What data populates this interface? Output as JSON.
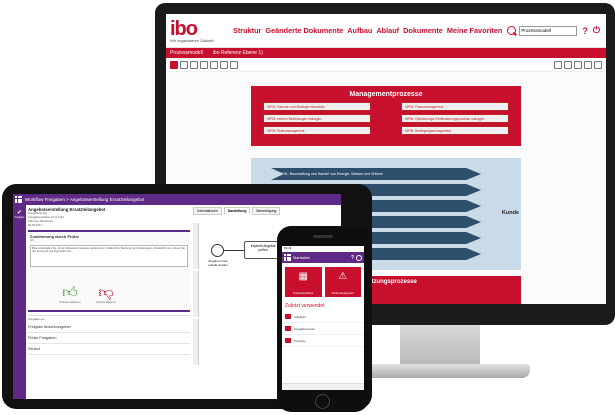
{
  "monitor": {
    "logo": "ibo",
    "tagline": "Wir organisieren Zukunft.",
    "nav": [
      "Struktur",
      "Geänderte Dokumente",
      "Aufbau",
      "Ablauf",
      "Dokumente",
      "Meine Favoriten"
    ],
    "search_value": "Prozessmodell",
    "help_label": "?",
    "power_label": "⏻",
    "breadcrumb": [
      "Prozessmodell",
      "ibo Referenz Ebene 1)"
    ],
    "management_title": "Managementprozesse",
    "management_items": [
      "MP01: Visionen und Strategie entwickeln",
      "MP04: Finanzmanagement",
      "MP02: externe Beziehungen managen",
      "MP06: Optimierungs-/Verbesserungsprozesse managen",
      "MP03: Risikomanagement",
      "MP05: Beteiligungsmanagement"
    ],
    "core_items": [
      "KP01: Beschaffung und Handel von Energie, Wasser und Wärme",
      "KP02: Verkauf von Energie, Wasser und Wärme",
      "...ung und Bau von Anlagen und Netzen",
      "...b und Instandhaltung von Anlagen und Netzen",
      "...von Energie-, Wasser- und Wärmedienstleistungen",
      "...eb von technischen Produkten und Dienstleistungen"
    ],
    "core_side_label": "Kunde",
    "support_title": "...rstützungsprozesse"
  },
  "tablet": {
    "header_title": "Workflow Freigaben > Angebotserstellung Ersatzteilangebot",
    "sidebar_label": "Freigabe",
    "doc_title": "Angebotserstellung Ersatzteilangebot",
    "doc_meta": [
      "Freigabeantrag",
      "Freigabeworkflow (v1.0.0.0p)",
      "Start des Workflows",
      "09.05.2017"
    ],
    "approval_title": "Zustimmung durch Prüfer",
    "approval_role": "Ich",
    "approval_hint": "Bitte entscheiden Sie, ob der Dokument freigeben werden kann. Sollten Ihrer Meinung nach Änderungen erforderlich sein, lehnen Sie den Antrag ab und begründen Sie...",
    "approve_label": "Prozess zustimmen",
    "reject_label": "Prozess ablehnen",
    "release_label": "Freigaben an",
    "collapsed_sections": [
      "Freigabe Abschlussgeber",
      "Finale Freigaben",
      "Verlauf"
    ],
    "tabs": [
      "Informationen",
      "Darstellung",
      "Berechtigung"
    ],
    "task1": "Kopierte Angebot prüfen",
    "task2": "Materialanfrage",
    "start_caption": "Angebot muss erstellt werden"
  },
  "phone": {
    "status": "09:41",
    "header_title": "Startseiten",
    "help_label": "?",
    "tile1": "Prozesslandkarte",
    "tile2": "Risikomanagement",
    "recent_title": "Zuletzt verwendet",
    "recent_items": [
      "Aufgaben",
      "Freigabeprozess",
      "Prozesse"
    ]
  },
  "colors": {
    "brand_red": "#c8102e",
    "workflow_purple": "#5e2a85",
    "core_blue": "#2e4e6c"
  }
}
